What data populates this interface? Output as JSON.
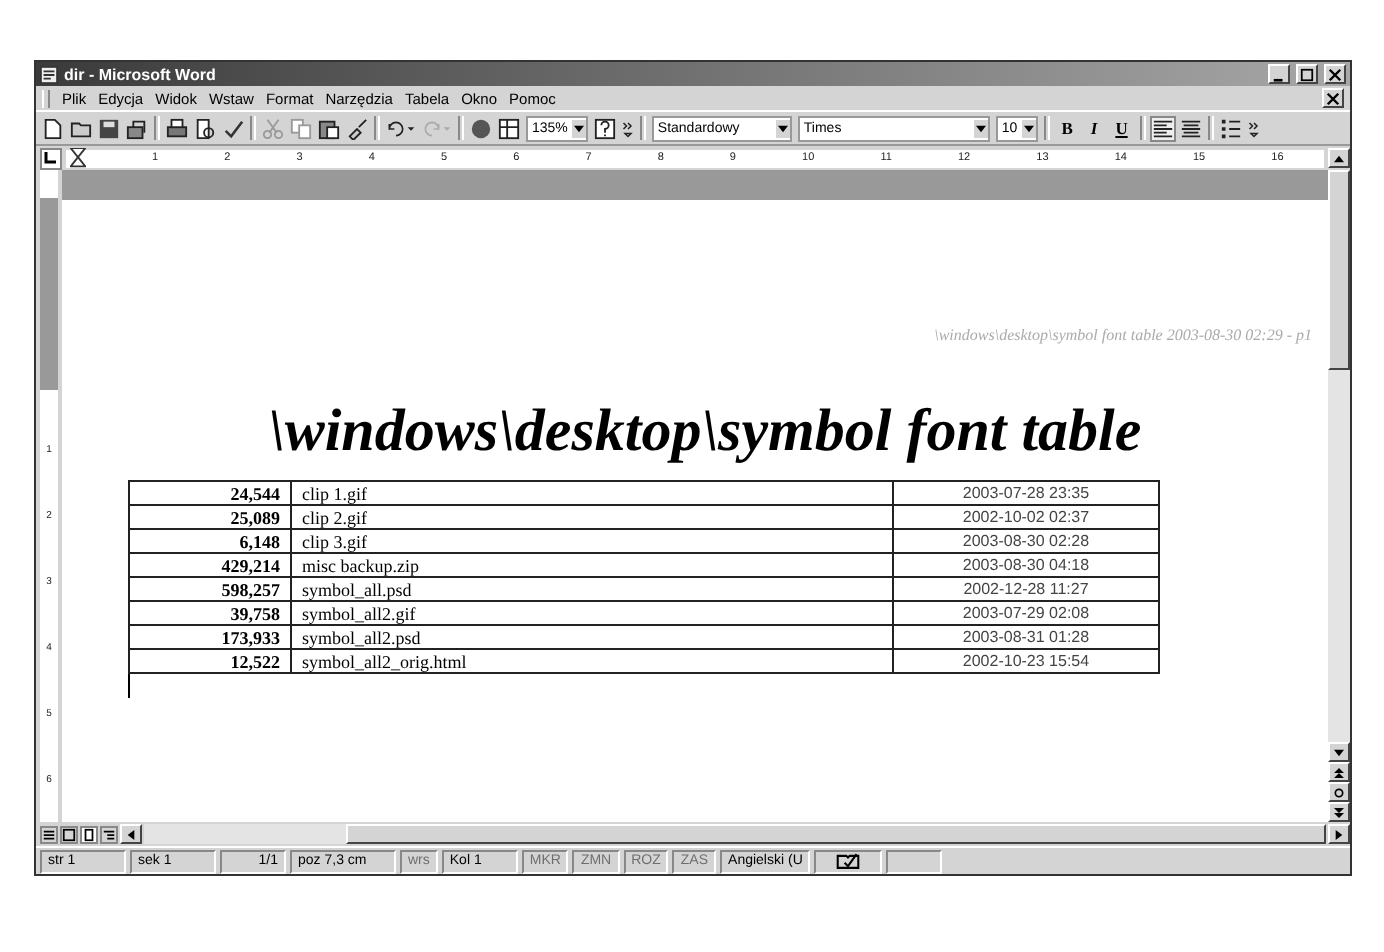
{
  "window": {
    "title": "dir - Microsoft Word"
  },
  "menu": [
    "Plik",
    "Edycja",
    "Widok",
    "Wstaw",
    "Format",
    "Narzędzia",
    "Tabela",
    "Okno",
    "Pomoc"
  ],
  "toolbar": {
    "zoom": "135%",
    "style": "Standardowy",
    "font": "Times",
    "size": "10",
    "bold": "B",
    "italic": "I",
    "underline": "U"
  },
  "ruler": [
    "1",
    "2",
    "3",
    "4",
    "5",
    "6",
    "7",
    "8",
    "9",
    "10",
    "11",
    "12",
    "13",
    "14",
    "15",
    "16"
  ],
  "vruler": [
    "1",
    "2",
    "3",
    "4",
    "5",
    "6"
  ],
  "document": {
    "header": "\\windows\\desktop\\symbol font table 2003-08-30 02:29 - p1",
    "title": "\\windows\\desktop\\symbol font table",
    "rows": [
      [
        "24,544",
        "clip 1.gif",
        "2003-07-28 23:35"
      ],
      [
        "25,089",
        "clip 2.gif",
        "2002-10-02 02:37"
      ],
      [
        "6,148",
        "clip 3.gif",
        "2003-08-30 02:28"
      ],
      [
        "429,214",
        "misc backup.zip",
        "2003-08-30 04:18"
      ],
      [
        "598,257",
        "symbol_all.psd",
        "2002-12-28 11:27"
      ],
      [
        "39,758",
        "symbol_all2.gif",
        "2003-07-29 02:08"
      ],
      [
        "173,933",
        "symbol_all2.psd",
        "2003-08-31 01:28"
      ],
      [
        "12,522",
        "symbol_all2_orig.html",
        "2002-10-23 15:54"
      ]
    ]
  },
  "status_bar": [
    {
      "text": "str 1",
      "disabled": false
    },
    {
      "text": "sek 1",
      "disabled": false
    },
    {
      "text": "1/1",
      "disabled": false
    },
    {
      "text": "poz 7,3 cm",
      "disabled": false
    },
    {
      "text": "wrs",
      "disabled": true
    },
    {
      "text": "Kol 1",
      "disabled": false
    },
    {
      "text": "MKR",
      "disabled": true
    },
    {
      "text": "ZMN",
      "disabled": true
    },
    {
      "text": "ROZ",
      "disabled": true
    },
    {
      "text": "ZAS",
      "disabled": true
    },
    {
      "text": "Angielski (U",
      "disabled": false
    }
  ]
}
